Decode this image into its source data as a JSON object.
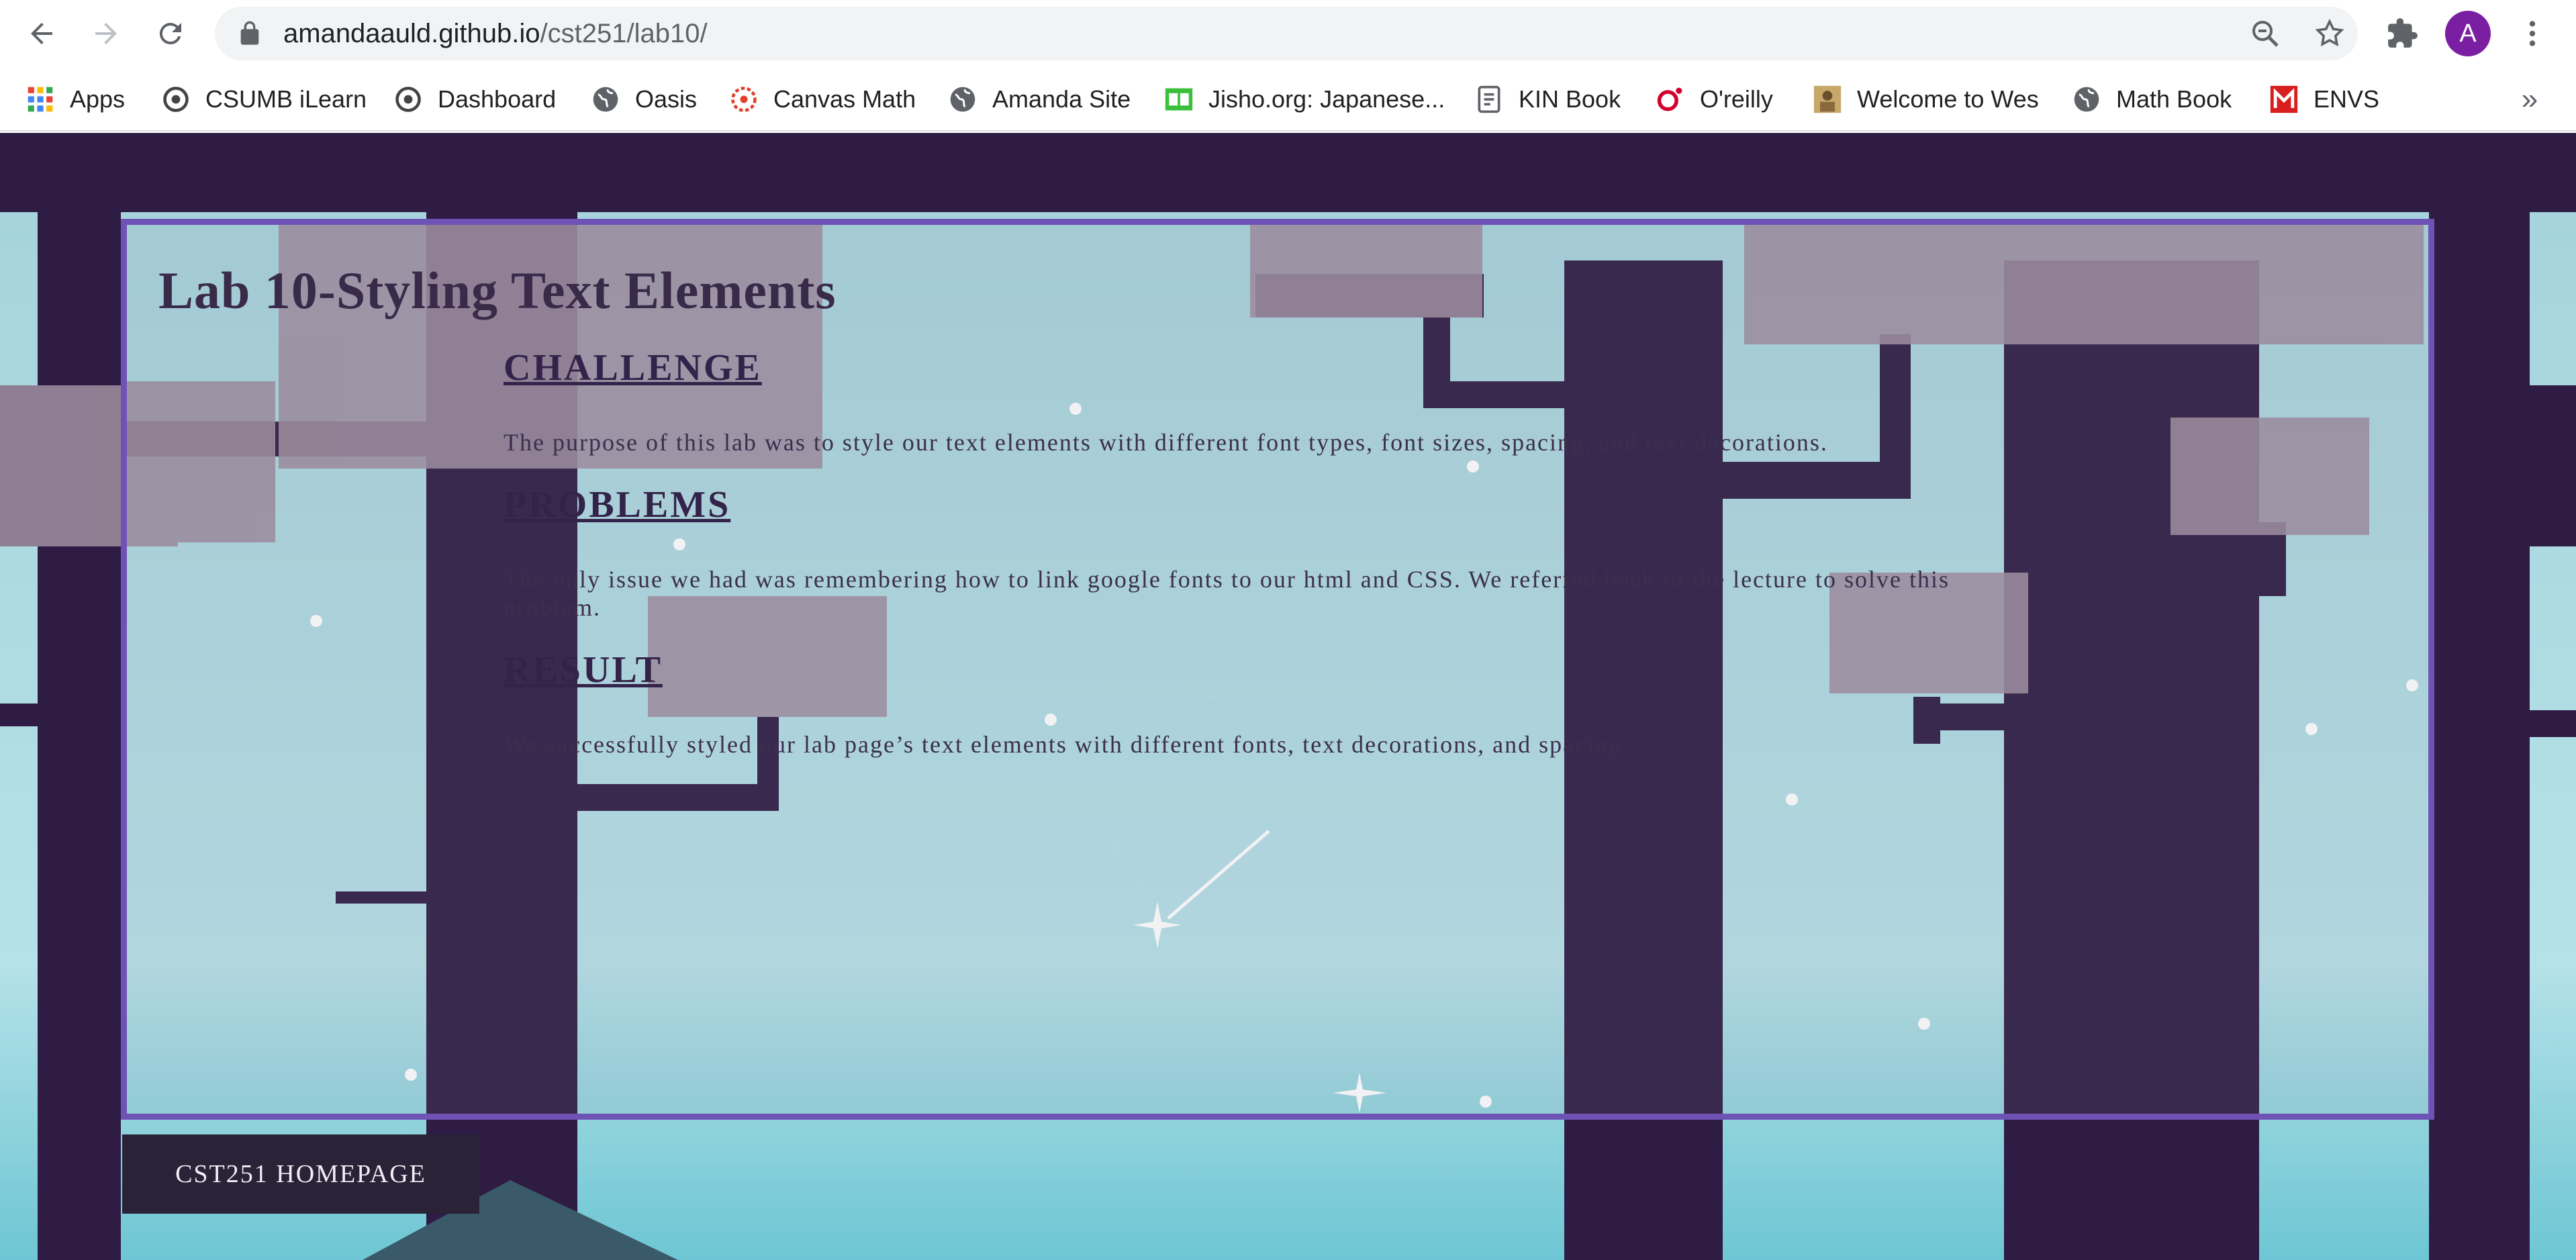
{
  "browser": {
    "url_host": "amandaauld.github.io",
    "url_path": "/cst251/lab10/",
    "profile_initial": "A",
    "more_bookmarks": "»"
  },
  "bookmarks": [
    {
      "label": "Apps",
      "icon": "apps-grid-icon"
    },
    {
      "label": "CSUMB iLearn",
      "icon": "ilearn-icon"
    },
    {
      "label": "Dashboard",
      "icon": "dashboard-icon"
    },
    {
      "label": "Oasis",
      "icon": "globe-icon"
    },
    {
      "label": "Canvas Math",
      "icon": "canvas-icon"
    },
    {
      "label": "Amanda Site",
      "icon": "globe-icon"
    },
    {
      "label": "Jisho.org: Japanese...",
      "icon": "jisho-icon"
    },
    {
      "label": "KIN Book",
      "icon": "document-icon"
    },
    {
      "label": "O'reilly",
      "icon": "oreilly-icon"
    },
    {
      "label": "Welcome to Wes",
      "icon": "wes-icon"
    },
    {
      "label": "Math Book",
      "icon": "globe-icon"
    },
    {
      "label": "ENVS",
      "icon": "envs-icon"
    }
  ],
  "page": {
    "title": "Lab 10-Styling Text Elements",
    "sections": [
      {
        "heading": "CHALLENGE",
        "text": "The purpose of this lab was to style our text elements with different font types, font sizes, spacing, and text decorations."
      },
      {
        "heading": "PROBLEMS",
        "text": "The only issue we had was remembering how to link google fonts to our html and CSS. We referred back to the lecture to solve this problem."
      },
      {
        "heading": "RESULT",
        "text": "We successfully styled our lab page’s text elements with different fonts, text decorations, and spacing."
      }
    ],
    "home_button": "CST251 HOMEPAGE"
  },
  "colors": {
    "card_border": "#6f52b6",
    "sky_top": "#a6d3dc",
    "sky_bottom": "#6ec6d4",
    "dark_purple": "#2e1c44",
    "button_bg": "#2a2236"
  }
}
